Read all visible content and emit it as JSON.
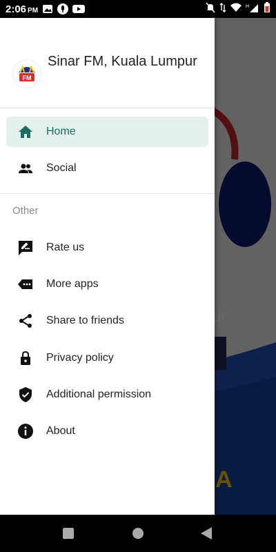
{
  "status_bar": {
    "time": "2:06",
    "time_suffix": "PM"
  },
  "drawer": {
    "station_name": "Sinar FM, Kuala Lumpur",
    "logo_text": "FM",
    "items_primary": [
      {
        "label": "Home",
        "icon": "home-icon",
        "active": true
      },
      {
        "label": "Social",
        "icon": "people-icon",
        "active": false
      }
    ],
    "section_label": "Other",
    "items_other": [
      {
        "label": "Rate us",
        "icon": "rate-icon"
      },
      {
        "label": "More apps",
        "icon": "more-apps-icon"
      },
      {
        "label": "Share to friends",
        "icon": "share-icon"
      },
      {
        "label": "Privacy policy",
        "icon": "lock-icon"
      },
      {
        "label": "Additional permission",
        "icon": "shield-check-icon"
      },
      {
        "label": "About",
        "icon": "info-icon"
      }
    ]
  },
  "background": {
    "partial_text": "ur",
    "partial_logo_text": "A"
  },
  "colors": {
    "accent": "#1a6d5f",
    "active_bg": "#e3f0ed"
  }
}
